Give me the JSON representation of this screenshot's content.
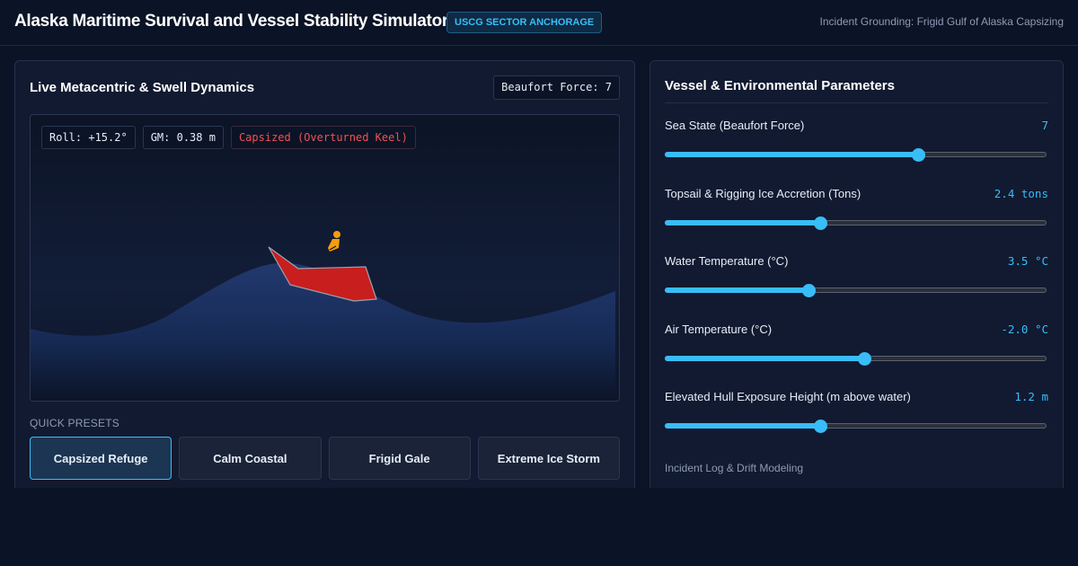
{
  "header": {
    "title": "Alaska Maritime Survival and Vessel Stability Simulator",
    "badge": "USCG SECTOR ANCHORAGE",
    "incident": "Incident Grounding: Frigid Gulf of Alaska Capsizing"
  },
  "sim_panel": {
    "title": "Live Metacentric & Swell Dynamics",
    "beaufort_chip": "Beaufort Force: 7",
    "readouts": {
      "roll": "Roll: +15.2°",
      "gm": "GM: 0.38 m",
      "status": "Capsized (Overturned Keel)"
    },
    "colors": {
      "hull": "#c81e1e",
      "survivor": "#f59e0b",
      "wave": "#1e3566",
      "status": "#f05252"
    }
  },
  "presets": {
    "label": "QUICK PRESETS",
    "items": [
      {
        "label": "Capsized Refuge",
        "active": true
      },
      {
        "label": "Calm Coastal",
        "active": false
      },
      {
        "label": "Frigid Gale",
        "active": false
      },
      {
        "label": "Extreme Ice Storm",
        "active": false
      }
    ]
  },
  "params_panel": {
    "title": "Vessel & Environmental Parameters",
    "accent": "#38bdf8",
    "params": [
      {
        "label": "Sea State (Beaufort Force)",
        "value": "7",
        "fraction": 0.66
      },
      {
        "label": "Topsail & Rigging Ice Accretion (Tons)",
        "value": "2.4 tons",
        "fraction": 0.405
      },
      {
        "label": "Water Temperature (°C)",
        "value": "3.5 °C",
        "fraction": 0.375
      },
      {
        "label": "Air Temperature (°C)",
        "value": "-2.0 °C",
        "fraction": 0.52
      },
      {
        "label": "Elevated Hull Exposure Height (m above water)",
        "value": "1.2 m",
        "fraction": 0.405
      }
    ],
    "log_title": "Incident Log & Drift Modeling"
  }
}
